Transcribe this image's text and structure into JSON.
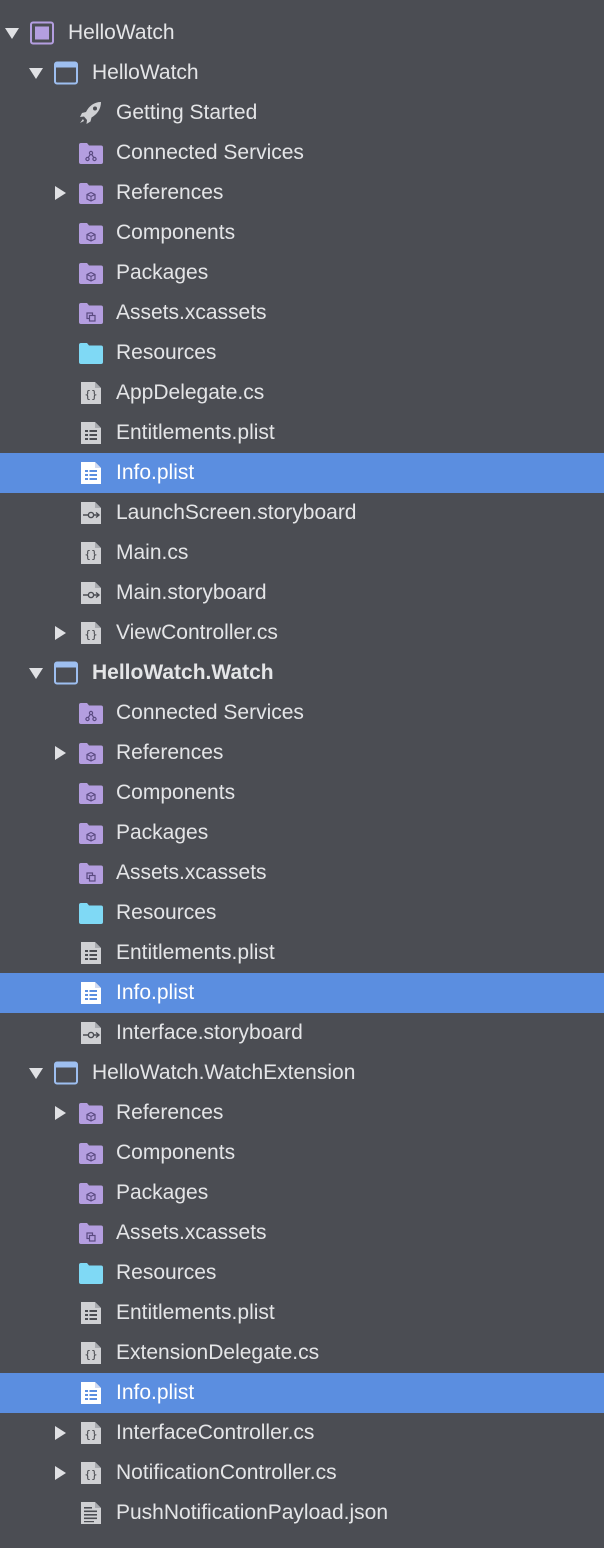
{
  "colors": {
    "background": "#4b4d53",
    "selection": "#5b8ee0",
    "text": "#e4e5e7",
    "folder_purple": "#b49ee0",
    "folder_cyan": "#7fd9f5",
    "project_blue": "#9ebff0",
    "file_gray": "#cfd0d3"
  },
  "tree": [
    {
      "label": "HelloWatch",
      "level": 0,
      "expander": "expanded",
      "icon": "solution-icon",
      "selected": false,
      "bold": false
    },
    {
      "label": "HelloWatch",
      "level": 1,
      "expander": "expanded",
      "icon": "project-icon",
      "selected": false,
      "bold": false
    },
    {
      "label": "Getting Started",
      "level": 2,
      "expander": "none",
      "icon": "rocket-icon",
      "selected": false,
      "bold": false
    },
    {
      "label": "Connected Services",
      "level": 2,
      "expander": "none",
      "icon": "connected-services-folder-icon",
      "selected": false,
      "bold": false
    },
    {
      "label": "References",
      "level": 2,
      "expander": "collapsed",
      "icon": "references-folder-icon",
      "selected": false,
      "bold": false
    },
    {
      "label": "Components",
      "level": 2,
      "expander": "none",
      "icon": "components-folder-icon",
      "selected": false,
      "bold": false
    },
    {
      "label": "Packages",
      "level": 2,
      "expander": "none",
      "icon": "packages-folder-icon",
      "selected": false,
      "bold": false
    },
    {
      "label": "Assets.xcassets",
      "level": 2,
      "expander": "none",
      "icon": "assets-folder-icon",
      "selected": false,
      "bold": false
    },
    {
      "label": "Resources",
      "level": 2,
      "expander": "none",
      "icon": "resources-folder-icon",
      "selected": false,
      "bold": false
    },
    {
      "label": "AppDelegate.cs",
      "level": 2,
      "expander": "none",
      "icon": "csharp-file-icon",
      "selected": false,
      "bold": false
    },
    {
      "label": "Entitlements.plist",
      "level": 2,
      "expander": "none",
      "icon": "plist-file-icon",
      "selected": false,
      "bold": false
    },
    {
      "label": "Info.plist",
      "level": 2,
      "expander": "none",
      "icon": "plist-file-icon",
      "selected": true,
      "bold": false
    },
    {
      "label": "LaunchScreen.storyboard",
      "level": 2,
      "expander": "none",
      "icon": "storyboard-file-icon",
      "selected": false,
      "bold": false
    },
    {
      "label": "Main.cs",
      "level": 2,
      "expander": "none",
      "icon": "csharp-file-icon",
      "selected": false,
      "bold": false
    },
    {
      "label": "Main.storyboard",
      "level": 2,
      "expander": "none",
      "icon": "storyboard-file-icon",
      "selected": false,
      "bold": false
    },
    {
      "label": "ViewController.cs",
      "level": 2,
      "expander": "collapsed",
      "icon": "csharp-file-icon",
      "selected": false,
      "bold": false
    },
    {
      "label": "HelloWatch.Watch",
      "level": 1,
      "expander": "expanded",
      "icon": "project-icon",
      "selected": false,
      "bold": true
    },
    {
      "label": "Connected Services",
      "level": 2,
      "expander": "none",
      "icon": "connected-services-folder-icon",
      "selected": false,
      "bold": false
    },
    {
      "label": "References",
      "level": 2,
      "expander": "collapsed",
      "icon": "references-folder-icon",
      "selected": false,
      "bold": false
    },
    {
      "label": "Components",
      "level": 2,
      "expander": "none",
      "icon": "components-folder-icon",
      "selected": false,
      "bold": false
    },
    {
      "label": "Packages",
      "level": 2,
      "expander": "none",
      "icon": "packages-folder-icon",
      "selected": false,
      "bold": false
    },
    {
      "label": "Assets.xcassets",
      "level": 2,
      "expander": "none",
      "icon": "assets-folder-icon",
      "selected": false,
      "bold": false
    },
    {
      "label": "Resources",
      "level": 2,
      "expander": "none",
      "icon": "resources-folder-icon",
      "selected": false,
      "bold": false
    },
    {
      "label": "Entitlements.plist",
      "level": 2,
      "expander": "none",
      "icon": "plist-file-icon",
      "selected": false,
      "bold": false
    },
    {
      "label": "Info.plist",
      "level": 2,
      "expander": "none",
      "icon": "plist-file-icon",
      "selected": true,
      "bold": false
    },
    {
      "label": "Interface.storyboard",
      "level": 2,
      "expander": "none",
      "icon": "storyboard-file-icon",
      "selected": false,
      "bold": false
    },
    {
      "label": "HelloWatch.WatchExtension",
      "level": 1,
      "expander": "expanded",
      "icon": "project-icon",
      "selected": false,
      "bold": false
    },
    {
      "label": "References",
      "level": 2,
      "expander": "collapsed",
      "icon": "references-folder-icon",
      "selected": false,
      "bold": false
    },
    {
      "label": "Components",
      "level": 2,
      "expander": "none",
      "icon": "components-folder-icon",
      "selected": false,
      "bold": false
    },
    {
      "label": "Packages",
      "level": 2,
      "expander": "none",
      "icon": "packages-folder-icon",
      "selected": false,
      "bold": false
    },
    {
      "label": "Assets.xcassets",
      "level": 2,
      "expander": "none",
      "icon": "assets-folder-icon",
      "selected": false,
      "bold": false
    },
    {
      "label": "Resources",
      "level": 2,
      "expander": "none",
      "icon": "resources-folder-icon",
      "selected": false,
      "bold": false
    },
    {
      "label": "Entitlements.plist",
      "level": 2,
      "expander": "none",
      "icon": "plist-file-icon",
      "selected": false,
      "bold": false
    },
    {
      "label": "ExtensionDelegate.cs",
      "level": 2,
      "expander": "none",
      "icon": "csharp-file-icon",
      "selected": false,
      "bold": false
    },
    {
      "label": "Info.plist",
      "level": 2,
      "expander": "none",
      "icon": "plist-file-icon",
      "selected": true,
      "bold": false
    },
    {
      "label": "InterfaceController.cs",
      "level": 2,
      "expander": "collapsed",
      "icon": "csharp-file-icon",
      "selected": false,
      "bold": false
    },
    {
      "label": "NotificationController.cs",
      "level": 2,
      "expander": "collapsed",
      "icon": "csharp-file-icon",
      "selected": false,
      "bold": false
    },
    {
      "label": "PushNotificationPayload.json",
      "level": 2,
      "expander": "none",
      "icon": "json-file-icon",
      "selected": false,
      "bold": false
    }
  ]
}
